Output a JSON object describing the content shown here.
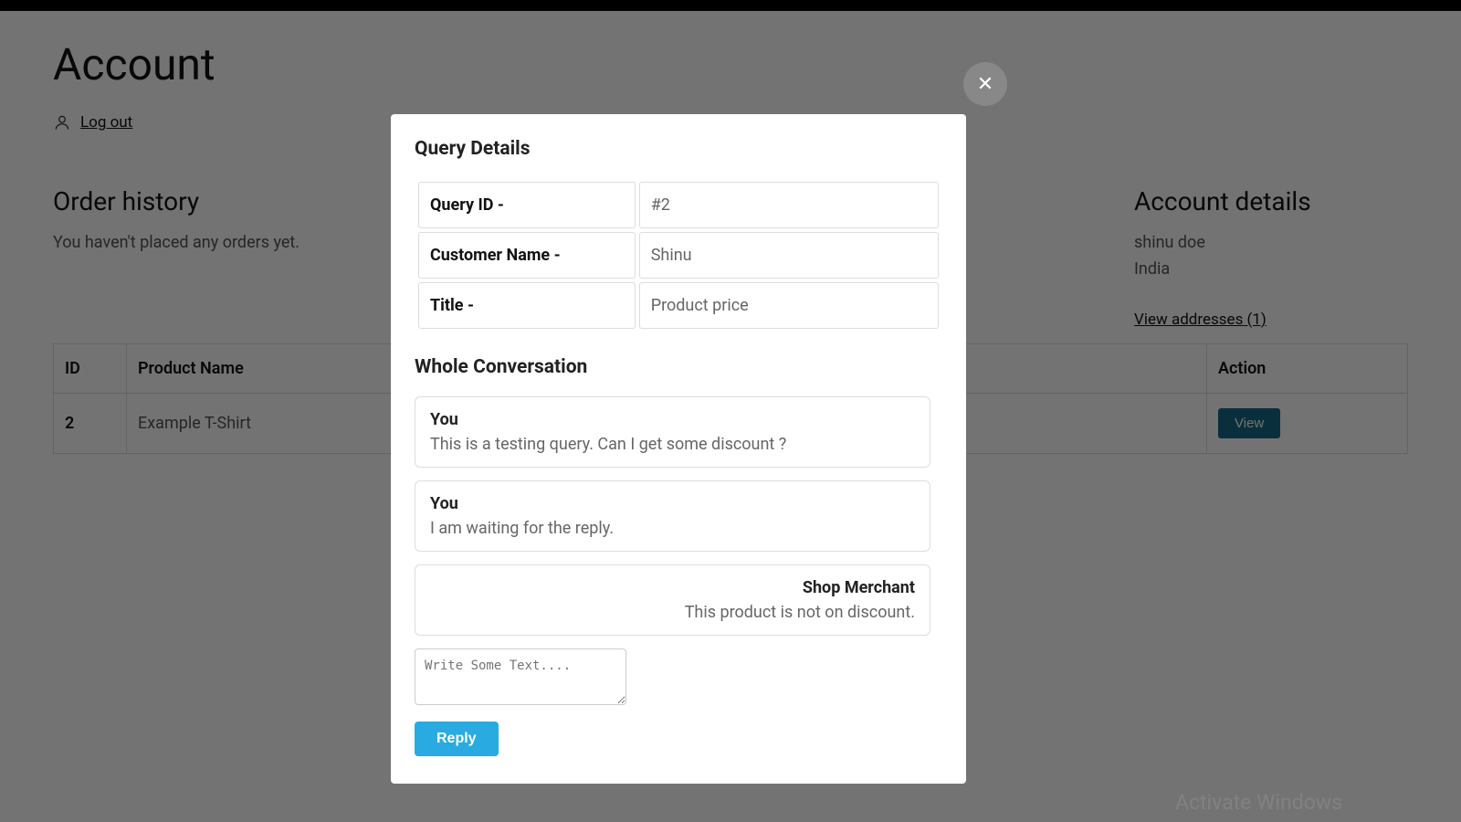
{
  "page": {
    "title": "Account",
    "logout_label": "Log out"
  },
  "order_history": {
    "title": "Order history",
    "empty_text": "You haven't placed any orders yet."
  },
  "account_details": {
    "title": "Account details",
    "name": "shinu doe",
    "country": "India",
    "view_addresses": "View addresses (1)"
  },
  "table": {
    "headers": {
      "id": "ID",
      "product_name": "Product Name",
      "action": "Action"
    },
    "rows": [
      {
        "id": "2",
        "product_name": "Example T-Shirt",
        "action_label": "View"
      }
    ]
  },
  "modal": {
    "query_heading": "Query Details",
    "labels": {
      "query_id": "Query ID -",
      "customer_name": "Customer Name -",
      "title": "Title -"
    },
    "values": {
      "query_id": "#2",
      "customer_name": "Shinu",
      "title": "Product price"
    },
    "conversation_heading": "Whole Conversation",
    "messages": [
      {
        "sender": "You",
        "text": "This is a testing query. Can I get some discount ?",
        "align": "left"
      },
      {
        "sender": "You",
        "text": "I am waiting for the reply.",
        "align": "left"
      },
      {
        "sender": "Shop Merchant",
        "text": "This product is not on discount.",
        "align": "right"
      }
    ],
    "reply_placeholder": "Write Some Text....",
    "reply_button": "Reply"
  },
  "watermark": "Activate Windows"
}
